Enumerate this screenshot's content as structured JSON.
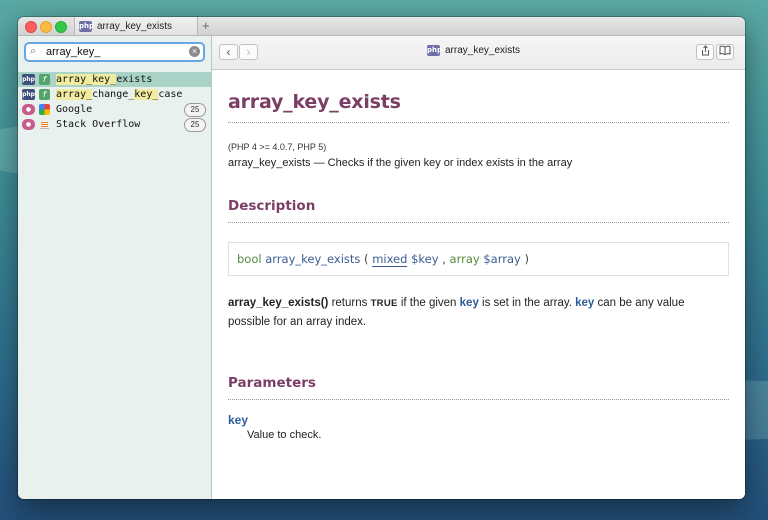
{
  "window": {
    "tab_title": "array_key_exists",
    "tab_badge": "php",
    "new_tab_label": "+"
  },
  "sidebar": {
    "search": {
      "value": "array_key_",
      "placeholder": ""
    },
    "results": [
      {
        "badge": "php",
        "type_icon": "f",
        "label_match": "array_key_",
        "label_rest": "exists",
        "selected": true
      },
      {
        "badge": "php",
        "type_icon": "f",
        "label_match": "array_",
        "label_mid": "change_",
        "label_match2": "key_",
        "label_rest": "case",
        "selected": false
      },
      {
        "badge": "",
        "label": "Google",
        "count": "25",
        "icon": "google-icon"
      },
      {
        "badge": "",
        "label": "Stack Overflow",
        "count": "25",
        "icon": "stackoverflow-icon"
      }
    ]
  },
  "toolbar": {
    "back": "‹",
    "forward": "›",
    "title": "array_key_exists",
    "badge": "php"
  },
  "doc": {
    "title": "array_key_exists",
    "version": "(PHP 4 >= 4.0.7, PHP 5)",
    "refpurpose": "array_key_exists — Checks if the given key or index exists in the array",
    "description_heading": "Description",
    "synopsis": {
      "return_type": "bool",
      "function": "array_key_exists",
      "open": "(",
      "param1_type": "mixed",
      "param1_var": "$key",
      "sep": ",",
      "param2_type": "array",
      "param2_var": "$array",
      "close": ")"
    },
    "para": {
      "fn": "array_key_exists()",
      "t1": " returns ",
      "const": "TRUE",
      "t2": " if the given ",
      "key1": "key",
      "t3": " is set in the array. ",
      "key2": "key",
      "t4": " can be any value possible for an array index."
    },
    "parameters_heading": "Parameters",
    "param_name": "key",
    "param_desc": "Value to check."
  }
}
